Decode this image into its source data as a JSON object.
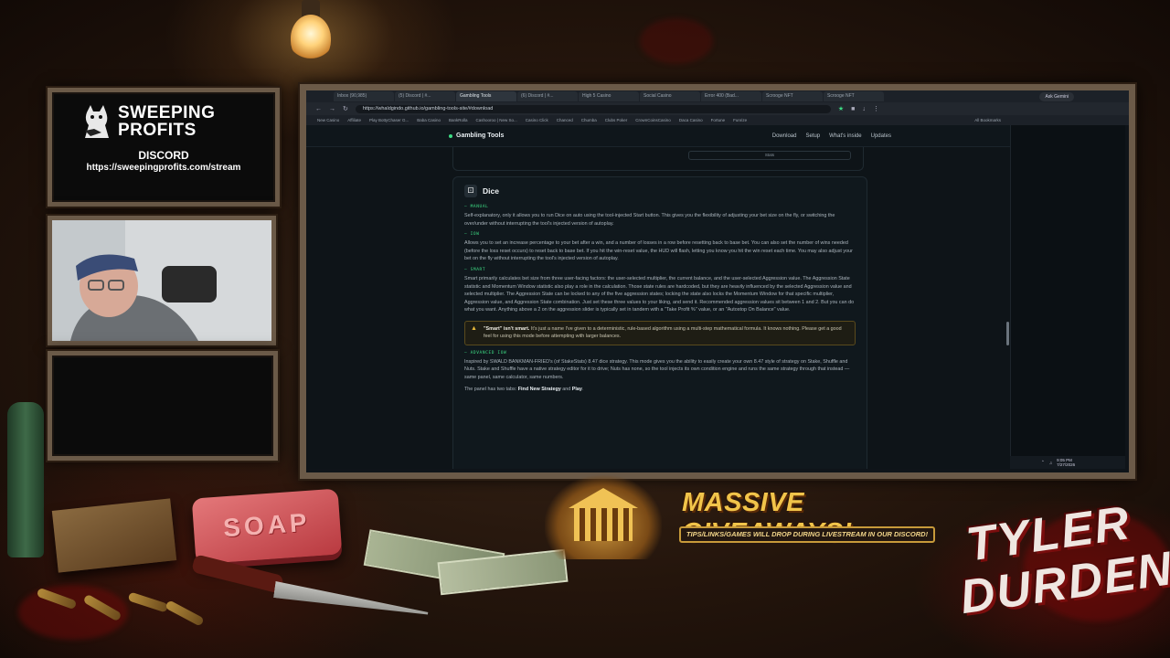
{
  "overlay": {
    "brand": {
      "line1": "SWEEPING",
      "line2": "PROFITS"
    },
    "discord_label": "DISCORD",
    "discord_url": "https://sweepingprofits.com/stream",
    "giveaway_title": "MASSIVE GIVEAWAYS!",
    "giveaway_sub": "TIPS/LINKS/GAMES WILL DROP DURING LIVESTREAM IN OUR DISCORD!",
    "tyler": {
      "line1": "TYLER",
      "line2": "DURDEN"
    },
    "soap": "SOAP"
  },
  "browser": {
    "tabs": [
      {
        "label": "Inbox (90,985)"
      },
      {
        "label": "(5) Discord | #..."
      },
      {
        "label": "Gambling Tools"
      },
      {
        "label": "(6) Discord | #..."
      },
      {
        "label": "High 5 Casino"
      },
      {
        "label": "Social Casino"
      },
      {
        "label": "Error 400 (Bad..."
      },
      {
        "label": "Scrooge NFT"
      },
      {
        "label": "Scrooge NFT"
      }
    ],
    "ask_gemini": "Ask Gemini",
    "url": "https://whaldgindo.github.io/gambling-tools-site/#download",
    "bookmarks": [
      "New Casino",
      "Affiliate",
      "Play BottyChaser G...",
      "Baba Casino",
      "BankRolla",
      "Cashooroo | New So...",
      "Casino Click",
      "Chanced",
      "Chumba",
      "Clubs Poker",
      "CrownCoinsCasino",
      "Daca Casino",
      "Fortune",
      "Funrize",
      "All Bookmarks"
    ],
    "clock": {
      "time": "9:05 PM",
      "date": "7/27/2026"
    }
  },
  "site": {
    "brand": "Gambling Tools",
    "nav": [
      "Download",
      "Setup",
      "What's inside",
      "Updates"
    ],
    "prev_card_stat": "Stats",
    "dice": {
      "title": "Dice",
      "sections": [
        {
          "label": "— MANUAL",
          "text": "Self-explanatory, only it allows you to run Dice on auto using the tool-injected Start button. This gives you the flexibility of adjusting your bet size on the fly, or switching the over/under without interrupting the tool's injected version of autoplay."
        },
        {
          "label": "— IOW",
          "text": "Allows you to set an increase percentage to your bet after a win, and a number of losses in a row before resetting back to base bet. You can also set the number of wins needed (before the loss reset occurs) to reset back to base bet. If you hit the win-reset value, the HUD will flash, letting you know you hit the win reset each time. You may also adjust your bet on the fly without interrupting the tool's injected version of autoplay."
        },
        {
          "label": "— SMART",
          "text": "Smart primarily calculates bet size from three user-facing factors: the user-selected multiplier, the current balance, and the user-selected Aggression value. The Aggression State statistic and Momentum Window statistic also play a role in the calculation. Those state rules are hardcoded, but they are heavily influenced by the selected Aggression value and selected multiplier. The Aggression State can be locked to any of the five aggression states; locking the state also locks the Momentum Window for that specific multiplier, Aggression value, and Aggression State combination. Just set these three values to your liking, and send it. Recommended aggression values sit between 1 and 2. But you can do what you want. Anything above a 2 on the aggression slider is typically set in tandem with a \"Take Profit %\" value, or an \"Autostop On Balance\" value."
        }
      ],
      "warning_bold": "\"Smart\" isn't smart.",
      "warning_text": " It's just a name I've given to a deterministic, rule-based algorithm using a multi-step mathematical formula. It knows nothing. Please get a good feel for using this mode before attempting with larger balances.",
      "advanced_label": "— ADVANCED IOW",
      "advanced_text": "Inspired by SWALD BANKMAN-FRIED's (of StakeStats) 8.47 dice strategy. This mode gives you the ability to easily create your own 8.47 style of strategy on Stake, Shuffle and Nuts. Stake and Shuffle have a native strategy editor for it to drive; Nuts has none, so the tool injects its own condition engine and runs the same strategy through that instead — same panel, same calculator, same numbers.",
      "tabs_line_prefix": "The panel has two tabs: ",
      "tabs_line_a": "Find New Strategy",
      "tabs_line_and": " and ",
      "tabs_line_b": "Play"
    }
  },
  "colors": {
    "accent": "#3ddc84",
    "warning": "#e5b73b",
    "giveaway_gold": "#f1c44a"
  }
}
